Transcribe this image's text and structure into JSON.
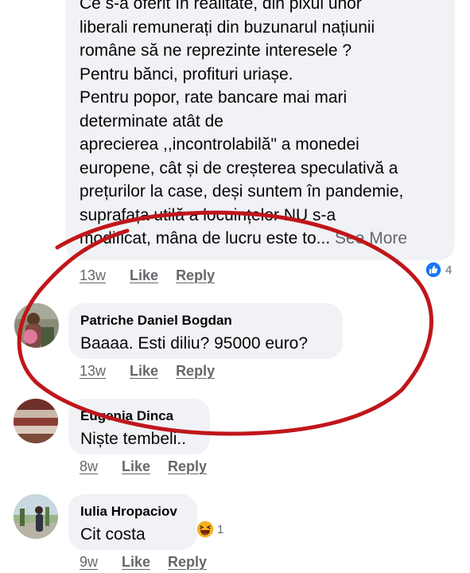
{
  "comments": [
    {
      "lines": [
        "Ce s-a oferit în realitate, din pixul unor",
        "liberali remunerați din buzunarul națiunii",
        "române să ne reprezinte interesele ?",
        "Pentru bănci, profituri uriașe.",
        "Pentru popor, rate bancare mai mari",
        "determinate atât de",
        "aprecierea ,,incontrolabilă\" a monedei",
        "europene, cât și de creșterea speculativă a",
        "prețurilor la case, deși suntem în pandemie,",
        "suprafața utilă a locuințelor NU s-a"
      ],
      "last_line": "modificat, mâna de lucru este to...",
      "see_more": "See More",
      "time": "13w",
      "like": "Like",
      "reply": "Reply",
      "reaction": {
        "icon": "like-reaction-icon",
        "count": "4",
        "color": "#1877f2"
      }
    },
    {
      "author": "Patriche Daniel Bogdan",
      "text": "Baaaa. Esti diliu? 95000 euro?",
      "time": "13w",
      "like": "Like",
      "reply": "Reply"
    },
    {
      "author": "Eugenia Dinca",
      "text": "Niște tembeli..",
      "time": "8w",
      "like": "Like",
      "reply": "Reply"
    },
    {
      "author": "Iulia Hropaciov",
      "text": "Cit costa",
      "time": "9w",
      "like": "Like",
      "reply": "Reply",
      "reaction": {
        "icon": "laugh-reaction-icon",
        "count": "1",
        "color": "#f7b125"
      }
    }
  ],
  "annotation_color": "#c0161b"
}
